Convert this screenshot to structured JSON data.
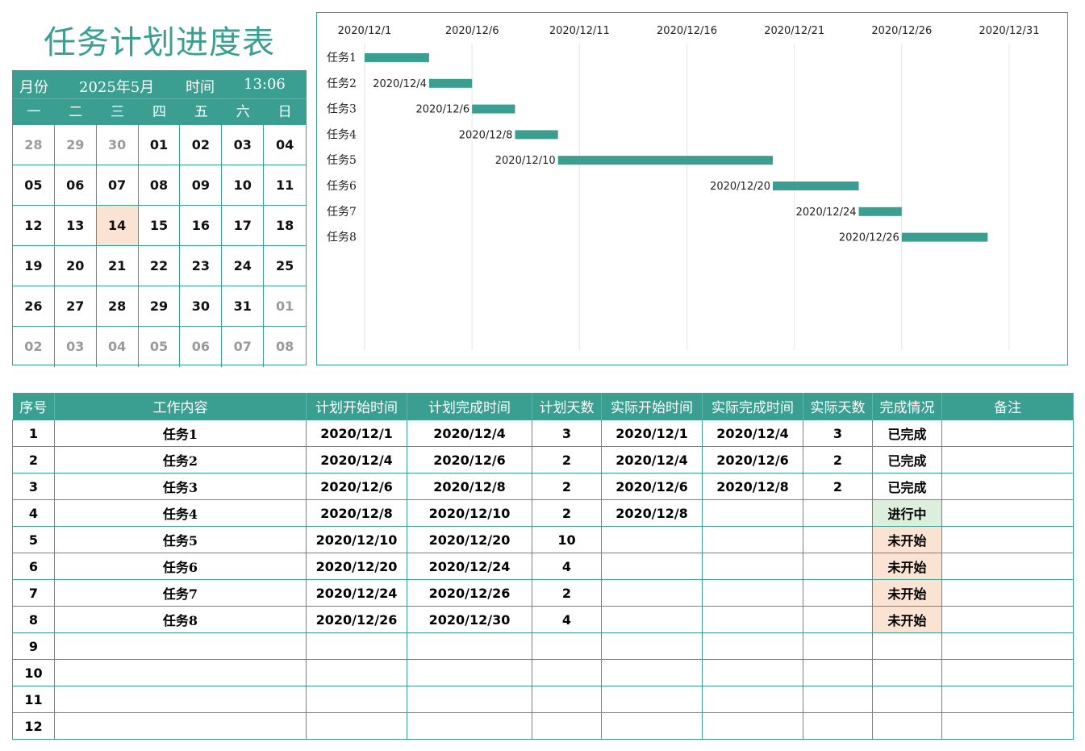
{
  "title": "任务计划进度表",
  "colors": {
    "accent": "#3a9e91",
    "today": "#fbe3d3",
    "in_progress": "#dcefdc",
    "not_started": "#fbe3d3"
  },
  "calendar": {
    "month_label": "月份",
    "month_value": "2025年5月",
    "time_label": "时间",
    "time_value": "13:06",
    "weekdays": [
      "一",
      "二",
      "三",
      "四",
      "五",
      "六",
      "日"
    ],
    "today": "14",
    "cells": [
      {
        "d": "28",
        "out": true
      },
      {
        "d": "29",
        "out": true
      },
      {
        "d": "30",
        "out": true
      },
      {
        "d": "01"
      },
      {
        "d": "02"
      },
      {
        "d": "03"
      },
      {
        "d": "04"
      },
      {
        "d": "05"
      },
      {
        "d": "06"
      },
      {
        "d": "07"
      },
      {
        "d": "08"
      },
      {
        "d": "09"
      },
      {
        "d": "10"
      },
      {
        "d": "11"
      },
      {
        "d": "12"
      },
      {
        "d": "13"
      },
      {
        "d": "14",
        "today": true
      },
      {
        "d": "15"
      },
      {
        "d": "16"
      },
      {
        "d": "17"
      },
      {
        "d": "18"
      },
      {
        "d": "19"
      },
      {
        "d": "20"
      },
      {
        "d": "21"
      },
      {
        "d": "22"
      },
      {
        "d": "23"
      },
      {
        "d": "24"
      },
      {
        "d": "25"
      },
      {
        "d": "26"
      },
      {
        "d": "27"
      },
      {
        "d": "28"
      },
      {
        "d": "29"
      },
      {
        "d": "30"
      },
      {
        "d": "31"
      },
      {
        "d": "01",
        "out": true
      },
      {
        "d": "02",
        "out": true
      },
      {
        "d": "03",
        "out": true
      },
      {
        "d": "04",
        "out": true
      },
      {
        "d": "05",
        "out": true
      },
      {
        "d": "06",
        "out": true
      },
      {
        "d": "07",
        "out": true
      },
      {
        "d": "08",
        "out": true
      }
    ]
  },
  "chart_data": {
    "type": "bar",
    "orientation": "horizontal-gantt",
    "x_axis_position": "top",
    "x_range": [
      "2020/12/1",
      "2020/12/31"
    ],
    "x_ticks": [
      "2020/12/1",
      "2020/12/6",
      "2020/12/11",
      "2020/12/16",
      "2020/12/21",
      "2020/12/26",
      "2020/12/31"
    ],
    "grid": true,
    "categories": [
      "任务1",
      "任务2",
      "任务3",
      "任务4",
      "任务5",
      "任务6",
      "任务7",
      "任务8"
    ],
    "series": [
      {
        "start": [
          "2020/12/1",
          "2020/12/4",
          "2020/12/6",
          "2020/12/8",
          "2020/12/10",
          "2020/12/20",
          "2020/12/24",
          "2020/12/26"
        ],
        "duration_days": [
          3,
          2,
          2,
          2,
          10,
          4,
          2,
          4
        ]
      }
    ],
    "start_labels": [
      "",
      "2020/12/4",
      "2020/12/6",
      "2020/12/8",
      "2020/12/10",
      "2020/12/20",
      "2020/12/24",
      "2020/12/26"
    ]
  },
  "table": {
    "headers": [
      "序号",
      "工作内容",
      "计划开始时间",
      "计划完成时间",
      "计划天数",
      "实际开始时间",
      "实际完成时间",
      "实际天数",
      "完成情况",
      "备注"
    ],
    "rows": [
      {
        "no": "1",
        "task": "任务1",
        "ps": "2020/12/1",
        "pe": "2020/12/4",
        "pd": "3",
        "as": "2020/12/1",
        "ae": "2020/12/4",
        "ad": "3",
        "status": "已完成",
        "st": "done",
        "note": ""
      },
      {
        "no": "2",
        "task": "任务2",
        "ps": "2020/12/4",
        "pe": "2020/12/6",
        "pd": "2",
        "as": "2020/12/4",
        "ae": "2020/12/6",
        "ad": "2",
        "status": "已完成",
        "st": "done",
        "note": ""
      },
      {
        "no": "3",
        "task": "任务3",
        "ps": "2020/12/6",
        "pe": "2020/12/8",
        "pd": "2",
        "as": "2020/12/6",
        "ae": "2020/12/8",
        "ad": "2",
        "status": "已完成",
        "st": "done",
        "note": ""
      },
      {
        "no": "4",
        "task": "任务4",
        "ps": "2020/12/8",
        "pe": "2020/12/10",
        "pd": "2",
        "as": "2020/12/8",
        "ae": "",
        "ad": "",
        "status": "进行中",
        "st": "doing",
        "note": ""
      },
      {
        "no": "5",
        "task": "任务5",
        "ps": "2020/12/10",
        "pe": "2020/12/20",
        "pd": "10",
        "as": "",
        "ae": "",
        "ad": "",
        "status": "未开始",
        "st": "todo",
        "note": ""
      },
      {
        "no": "6",
        "task": "任务6",
        "ps": "2020/12/20",
        "pe": "2020/12/24",
        "pd": "4",
        "as": "",
        "ae": "",
        "ad": "",
        "status": "未开始",
        "st": "todo",
        "note": ""
      },
      {
        "no": "7",
        "task": "任务7",
        "ps": "2020/12/24",
        "pe": "2020/12/26",
        "pd": "2",
        "as": "",
        "ae": "",
        "ad": "",
        "status": "未开始",
        "st": "todo",
        "note": ""
      },
      {
        "no": "8",
        "task": "任务8",
        "ps": "2020/12/26",
        "pe": "2020/12/30",
        "pd": "4",
        "as": "",
        "ae": "",
        "ad": "",
        "status": "未开始",
        "st": "todo",
        "note": ""
      },
      {
        "no": "9",
        "task": "",
        "ps": "",
        "pe": "",
        "pd": "",
        "as": "",
        "ae": "",
        "ad": "",
        "status": "",
        "st": "",
        "note": ""
      },
      {
        "no": "10",
        "task": "",
        "ps": "",
        "pe": "",
        "pd": "",
        "as": "",
        "ae": "",
        "ad": "",
        "status": "",
        "st": "",
        "note": ""
      },
      {
        "no": "11",
        "task": "",
        "ps": "",
        "pe": "",
        "pd": "",
        "as": "",
        "ae": "",
        "ad": "",
        "status": "",
        "st": "",
        "note": ""
      },
      {
        "no": "12",
        "task": "",
        "ps": "",
        "pe": "",
        "pd": "",
        "as": "",
        "ae": "",
        "ad": "",
        "status": "",
        "st": "",
        "note": ""
      }
    ]
  }
}
